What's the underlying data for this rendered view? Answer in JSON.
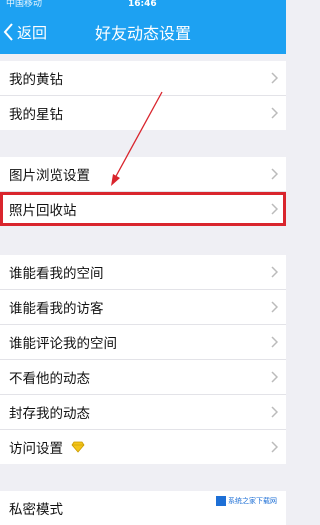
{
  "status_bar": {
    "carrier": "中国移动",
    "time": "16:46"
  },
  "nav": {
    "back_label": "返回",
    "title": "好友动态设置"
  },
  "groups": [
    {
      "items": [
        {
          "label": "我的黄钻"
        },
        {
          "label": "我的星钻"
        }
      ]
    },
    {
      "items": [
        {
          "label": "图片浏览设置"
        },
        {
          "label": "照片回收站"
        }
      ]
    },
    {
      "items": [
        {
          "label": "谁能看我的空间"
        },
        {
          "label": "谁能看我的访客"
        },
        {
          "label": "谁能评论我的空间"
        },
        {
          "label": "不看他的动态"
        },
        {
          "label": "封存我的动态"
        },
        {
          "label": "访问设置"
        }
      ]
    },
    {
      "items": [
        {
          "label": "私密模式"
        }
      ]
    }
  ],
  "highlighted_item": "照片回收站",
  "annotation": {
    "color": "#d9252d"
  },
  "watermark": {
    "text": "系统之家下载网"
  },
  "colors": {
    "accent": "#1da1f2",
    "background": "#efeff4",
    "highlight": "#d9252d"
  }
}
